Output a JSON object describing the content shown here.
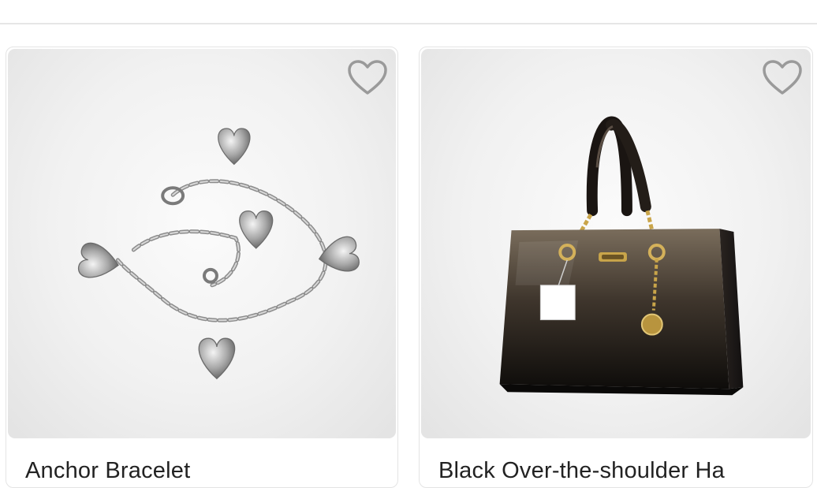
{
  "products": [
    {
      "name": "Anchor Bracelet",
      "image_icon": "bracelet-image",
      "favorite_icon": "heart-outline-icon"
    },
    {
      "name": "Black Over-the-shoulder Ha",
      "image_icon": "handbag-image",
      "favorite_icon": "heart-outline-icon"
    }
  ],
  "colors": {
    "card_border": "#e4e4e4",
    "heart_outline": "#9a9a9a",
    "title_text": "#222222"
  }
}
